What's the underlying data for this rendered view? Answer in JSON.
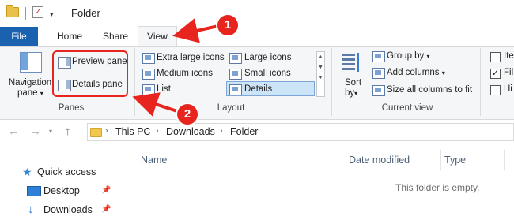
{
  "window": {
    "title": "Folder"
  },
  "tabs": {
    "file": "File",
    "home": "Home",
    "share": "Share",
    "view": "View"
  },
  "ribbon": {
    "panes": {
      "group_label": "Panes",
      "navigation_pane_line1": "Navigation",
      "navigation_pane_line2": "pane",
      "preview_pane": "Preview pane",
      "details_pane": "Details pane"
    },
    "layout": {
      "group_label": "Layout",
      "options": [
        "Extra large icons",
        "Large icons",
        "Medium icons",
        "Small icons",
        "List",
        "Details"
      ],
      "selected": "Details"
    },
    "current_view": {
      "group_label": "Current view",
      "sort_by_line1": "Sort",
      "sort_by_line2": "by",
      "group_by": "Group by",
      "add_columns": "Add columns",
      "size_all_columns": "Size all columns to fit"
    },
    "show_hide": {
      "items": [
        "Ite",
        "Fil",
        "Hi"
      ],
      "checked": [
        false,
        true,
        false
      ]
    }
  },
  "address_bar": {
    "crumbs": [
      "This PC",
      "Downloads",
      "Folder"
    ]
  },
  "nav_tree": [
    {
      "label": "Quick access",
      "icon": "star-icon"
    },
    {
      "label": "Desktop",
      "icon": "desktop-icon"
    },
    {
      "label": "Downloads",
      "icon": "download-arrow-icon"
    }
  ],
  "file_list": {
    "columns": [
      "Name",
      "Date modified",
      "Type"
    ],
    "empty_message": "This folder is empty."
  },
  "annotations": {
    "badge1": "1",
    "badge2": "2"
  },
  "colors": {
    "file_tab": "#1a62b0",
    "annotation": "#e8241f",
    "selection": "#cce4f7"
  }
}
